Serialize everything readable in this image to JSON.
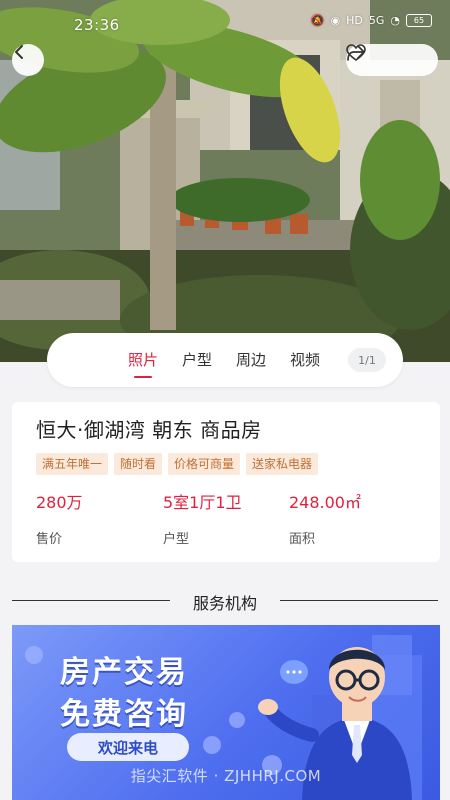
{
  "status_bar": {
    "time": "23:36",
    "signal": "5G",
    "hd": "HD",
    "battery": "65"
  },
  "icons": {
    "back": "chevron-left-icon",
    "share": "share-icon",
    "favorite": "heart-icon"
  },
  "tabs": [
    {
      "label": "照片",
      "active": true
    },
    {
      "label": "户型",
      "active": false
    },
    {
      "label": "周边",
      "active": false
    },
    {
      "label": "视频",
      "active": false
    }
  ],
  "photo_counter": "1/1",
  "listing": {
    "title": "恒大·御湖湾 朝东 商品房",
    "tags": [
      "满五年唯一",
      "随时看",
      "价格可商量",
      "送家私电器"
    ],
    "stats": [
      {
        "value": "280万",
        "label": "售价"
      },
      {
        "value": "5室1厅1卫",
        "label": "户型"
      },
      {
        "value": "248.00㎡",
        "label": "面积"
      }
    ]
  },
  "service_section": {
    "title": "服务机构"
  },
  "banner": {
    "line1": "房产交易",
    "line2": "免费咨询",
    "button": "欢迎来电",
    "watermark": "指尖汇软件 · ZJHHRJ.COM"
  },
  "colors": {
    "accent": "#e0213e",
    "tag_bg": "#fbeadb",
    "tag_text": "#c07034",
    "banner_blue": "#4f6ff0"
  }
}
